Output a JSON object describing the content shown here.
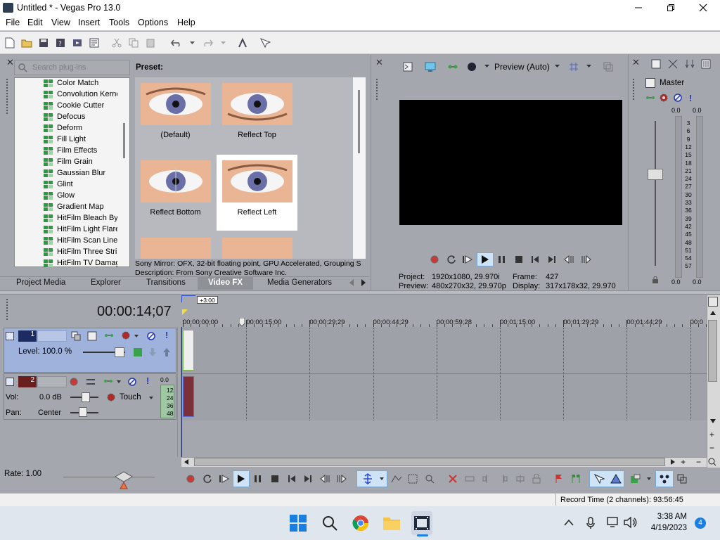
{
  "window": {
    "title": "Untitled * - Vegas Pro 13.0"
  },
  "menu": [
    "File",
    "Edit",
    "View",
    "Insert",
    "Tools",
    "Options",
    "Help"
  ],
  "plugins": {
    "search_placeholder": "Search plug-ins",
    "items": [
      "Color Match",
      "Convolution Kerne",
      "Cookie Cutter",
      "Defocus",
      "Deform",
      "Fill Light",
      "Film Effects",
      "Film Grain",
      "Gaussian Blur",
      "Glint",
      "Glow",
      "Gradient Map",
      "HitFilm Bleach Byp",
      "HitFilm Light Flares",
      "HitFilm Scan Lines",
      "HitFilm Three Strip",
      "HitFilm TV Damage"
    ]
  },
  "preset": {
    "header": "Preset:",
    "items": [
      "(Default)",
      "Reflect Top",
      "Reflect Bottom",
      "Reflect Left"
    ],
    "info_line1": "Sony Mirror: OFX, 32-bit floating point, GPU Accelerated, Grouping S",
    "info_line2": "Description: From Sony Creative Software Inc."
  },
  "tabs": [
    "Project Media",
    "Explorer",
    "Transitions",
    "Video FX",
    "Media Generators"
  ],
  "preview": {
    "mode": "Preview (Auto)",
    "project_label": "Project:",
    "project_value": "1920x1080, 29.970i",
    "frame_label": "Frame:",
    "frame_value": "427",
    "preview_label": "Preview:",
    "preview_value": "480x270x32, 29.970p",
    "display_label": "Display:",
    "display_value": "317x178x32, 29.970"
  },
  "mixer": {
    "master": "Master",
    "peak_left": "0.0",
    "peak_right": "0.0",
    "scale": [
      "3",
      "6",
      "9",
      "12",
      "15",
      "18",
      "21",
      "24",
      "27",
      "30",
      "33",
      "36",
      "39",
      "42",
      "45",
      "48",
      "51",
      "54",
      "57"
    ],
    "bottom_left": "0.0",
    "bottom_right": "0.0"
  },
  "timeline": {
    "timecode": "00:00:14;07",
    "marker": "+3:00",
    "ruler": [
      "00:00:00;00",
      "00:00:15;00",
      "00:00:29;29",
      "00:00:44;29",
      "00:00:59;28",
      "00:01:15;00",
      "00:01:29;29",
      "00:01:44;29",
      "00:0"
    ]
  },
  "track1": {
    "number": "1",
    "level": "Level: 100.0 %"
  },
  "track2": {
    "number": "2",
    "vol_label": "Vol:",
    "vol_value": "0.0 dB",
    "pan_label": "Pan:",
    "pan_value": "Center",
    "mode": "Touch",
    "meter_top": "0.0",
    "meter": [
      "12",
      "24",
      "36",
      "48"
    ]
  },
  "rate": "Rate: 1.00",
  "status": "Record Time (2 channels): 93:56:45",
  "taskbar": {
    "time": "3:38 AM",
    "date": "4/19/2023",
    "badge": "4"
  }
}
